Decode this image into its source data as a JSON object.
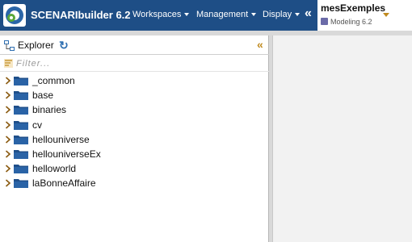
{
  "app": {
    "title": "SCENARIbuilder 6.2",
    "logo_icon": "scenari-logo-icon"
  },
  "menu": {
    "items": [
      {
        "label": "Workspaces"
      },
      {
        "label": "Management"
      },
      {
        "label": "Display"
      }
    ],
    "collapse_glyph": "«"
  },
  "workspace": {
    "name": "mesExemples",
    "model": "Modeling 6.2"
  },
  "explorer": {
    "title": "Explorer",
    "refresh_glyph": "↻",
    "collapse_glyph": "«",
    "filter_placeholder": "Filter...",
    "items": [
      {
        "label": "_common"
      },
      {
        "label": "base"
      },
      {
        "label": "binaries"
      },
      {
        "label": "cv"
      },
      {
        "label": "hellouniverse"
      },
      {
        "label": "hellouniverseEx"
      },
      {
        "label": "helloworld"
      },
      {
        "label": "laBonneAffaire"
      }
    ]
  },
  "colors": {
    "topbar": "#1e4e86",
    "accent": "#c08a1e",
    "folder": "#1f4f8a"
  }
}
